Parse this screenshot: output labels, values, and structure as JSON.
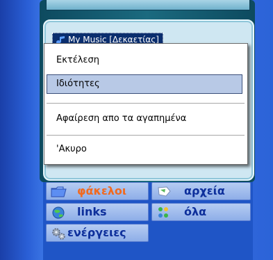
{
  "playlist": {
    "selected_item": "My Music [Δεκαετίας]"
  },
  "context_menu": {
    "items": [
      {
        "label": "Εκτέλεση"
      },
      {
        "label": "Ιδιότητες",
        "selected": true
      },
      {
        "label": "Αφαίρεση απο τα αγαπημένα"
      },
      {
        "label": "'Ακυρο"
      }
    ]
  },
  "nav": {
    "folders": "φάκελοι",
    "files": "αρχεία",
    "links": "links",
    "all": "όλα",
    "actions": "ενέργειες"
  },
  "colors": {
    "active_tab_text": "#f06a20",
    "tab_text": "#0d2f9b",
    "menu_highlight": "#b8c9e6"
  }
}
